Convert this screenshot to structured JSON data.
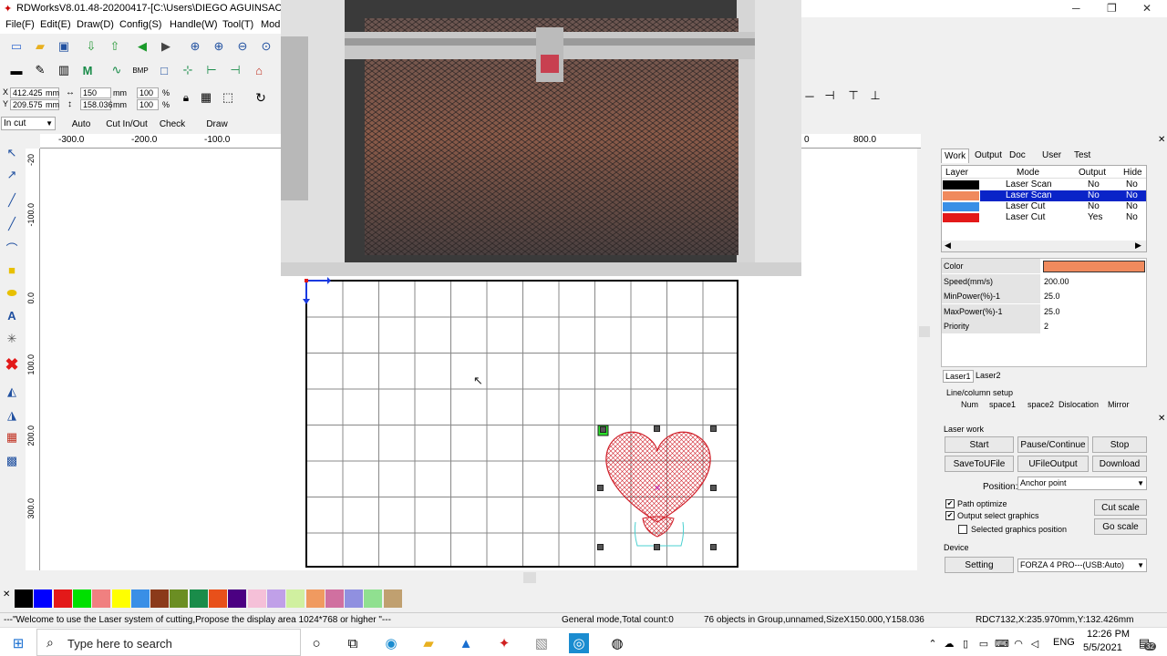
{
  "window": {
    "title": "RDWorksV8.01.48-20200417-[C:\\Users\\DIEGO AGUINSACA\\OneDr",
    "minimize": "─",
    "maximize": "❐",
    "close": "✕"
  },
  "menu": [
    "File(F)",
    "Edit(E)",
    "Draw(D)",
    "Config(S)",
    "Handle(W)",
    "Tool(T)",
    "Mod"
  ],
  "position": {
    "x_value": "412.425",
    "y_value": "209.575",
    "x_unit": "mm",
    "y_unit": "mm",
    "w_value": "150",
    "h_value": "158.036",
    "w_unit": "mm",
    "h_unit": "mm",
    "w_percent": "100",
    "h_percent": "100",
    "pct1": "%",
    "pct2": "%",
    "x_label": "X",
    "y_label": "Y"
  },
  "cut_mode": {
    "select": "In cut",
    "buttons": [
      "Auto",
      "Cut In/Out",
      "Check",
      "Draw"
    ]
  },
  "rulers": {
    "top": [
      "-300.0",
      "-200.0",
      "-100.0",
      "0",
      "800.0"
    ],
    "left": [
      "-20",
      "-100.0",
      "0.0",
      "100.0",
      "200.0",
      "300.0"
    ]
  },
  "panel": {
    "tabs": [
      "Work",
      "Output",
      "Doc",
      "User",
      "Test"
    ],
    "headers": [
      "Layer",
      "Mode",
      "Output",
      "Hide"
    ],
    "layers": [
      {
        "color": "#000000",
        "mode": "Laser Scan",
        "output": "No",
        "hide": "No",
        "selected": false
      },
      {
        "color": "#f08a5d",
        "mode": "Laser Scan",
        "output": "No",
        "hide": "No",
        "selected": true
      },
      {
        "color": "#3a8fe6",
        "mode": "Laser Cut",
        "output": "No",
        "hide": "No",
        "selected": false
      },
      {
        "color": "#e31919",
        "mode": "Laser Cut",
        "output": "Yes",
        "hide": "No",
        "selected": false
      }
    ],
    "props": [
      {
        "label": "Color",
        "value": ""
      },
      {
        "label": "Speed(mm/s)",
        "value": "200.00"
      },
      {
        "label": "MinPower(%)-1",
        "value": "25.0"
      },
      {
        "label": "MaxPower(%)-1",
        "value": "25.0"
      },
      {
        "label": "Priority",
        "value": "2"
      }
    ],
    "color_value": "#f08a5d",
    "laser_tabs": [
      "Laser1",
      "Laser2"
    ],
    "line_column_setup": "Line/column setup",
    "lc_headers": [
      "Num",
      "space1",
      "space2",
      "Dislocation",
      "Mirror"
    ]
  },
  "laser_work": {
    "title": "Laser work",
    "buttons_row1": [
      "Start",
      "Pause/Continue",
      "Stop"
    ],
    "buttons_row2": [
      "SaveToUFile",
      "UFileOutput",
      "Download"
    ],
    "position_label": "Position:",
    "position_value": "Anchor point",
    "path_optimize": "Path optimize",
    "output_select": "Output select graphics",
    "selected_pos": "Selected graphics position",
    "cut_scale": "Cut scale",
    "go_scale": "Go scale",
    "device_title": "Device",
    "setting": "Setting",
    "device_value": "FORZA 4 PRO---(USB:Auto)"
  },
  "palette": [
    "#000000",
    "#0000ff",
    "#e31919",
    "#00e000",
    "#f08080",
    "#ffff00",
    "#3a8fe6",
    "#8b3a1a",
    "#6b8e23",
    "#1a8c4a",
    "#e8501a",
    "#4b0082",
    "#f5c0d8",
    "#c0a0e8",
    "#d0f0a0",
    "#f09a60",
    "#d070a0",
    "#9090e0",
    "#90e090",
    "#c0a070"
  ],
  "status": {
    "message": "---\"Welcome to use the Laser system of cutting,Propose the display area 1024*768 or higher \"---",
    "mode": "General mode,Total count:0",
    "objects": "76 objects in Group,unnamed,SizeX150.000,Y158.036",
    "coords": "RDC7132,X:235.970mm,Y:132.426mm"
  },
  "taskbar": {
    "search_placeholder": "Type here to search",
    "lang": "ENG",
    "time": "12:26 PM",
    "date": "5/5/2021",
    "notif": "32"
  }
}
